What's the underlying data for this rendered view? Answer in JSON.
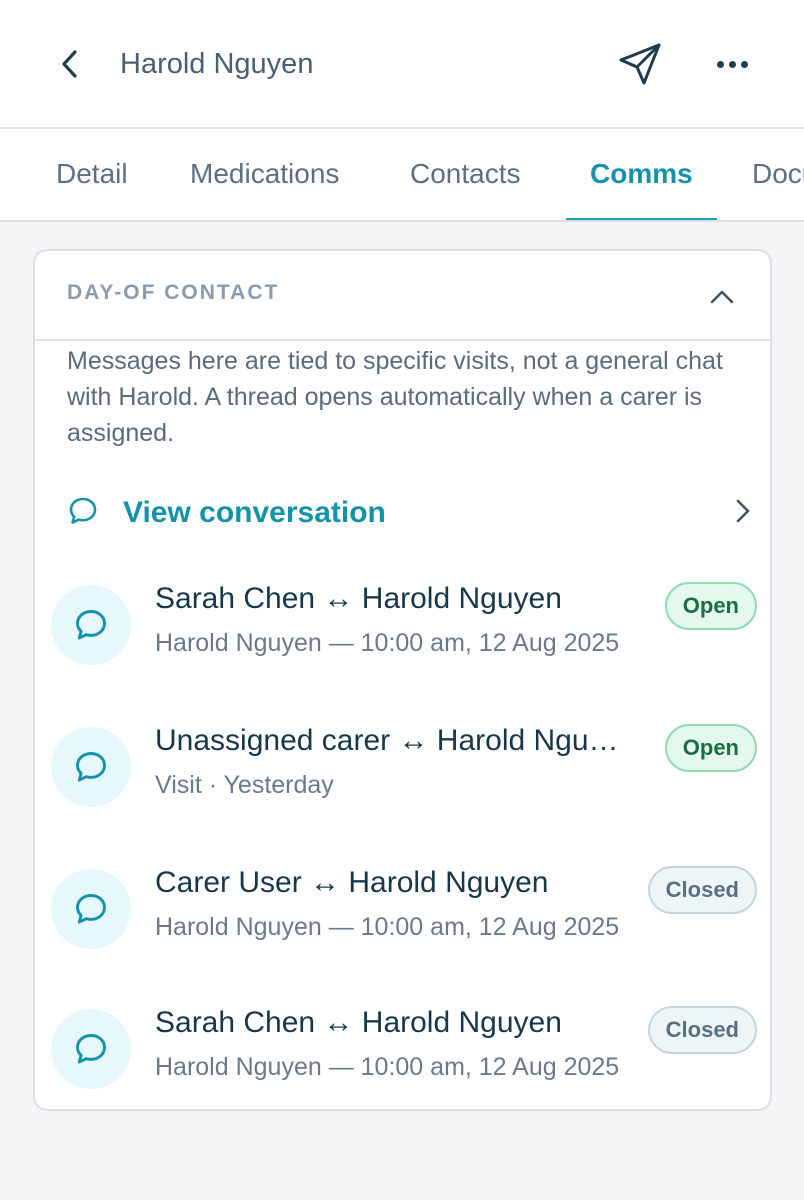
{
  "header": {
    "title": "Harold Nguyen",
    "back_icon": "chevron-left-icon",
    "send_icon": "send-icon",
    "more_icon": "more-horizontal-icon"
  },
  "tabs": [
    {
      "label": "Detail",
      "active": false
    },
    {
      "label": "Medications",
      "active": false
    },
    {
      "label": "Contacts",
      "active": false
    },
    {
      "label": "Comms",
      "active": true
    },
    {
      "label": "Documents",
      "active": false
    }
  ],
  "section": {
    "label": "DAY-OF CONTACT",
    "description": "Messages here are tied to specific visits, not a general chat with Harold. A thread opens automatically when a carer is assigned.",
    "view_conversation": "View conversation"
  },
  "threads": [
    {
      "title": "Sarah Chen ↔ Harold Nguyen",
      "subtitle": "Harold Nguyen — 10:00 am, 12 Aug 2025",
      "status": "Open"
    },
    {
      "title": "Unassigned carer ↔ Harold Nguyen",
      "subtitle": "Visit · Yesterday",
      "status": "Open"
    },
    {
      "title": "Carer User ↔ Harold Nguyen",
      "subtitle": "Harold Nguyen — 10:00 am, 12 Aug 2025",
      "status": "Closed"
    },
    {
      "title": "Sarah Chen ↔ Harold Nguyen",
      "subtitle": "Harold Nguyen — 10:00 am, 12 Aug 2025",
      "status": "Closed"
    }
  ],
  "colors": {
    "accent": "#1592ab",
    "open_badge_bg": "#e4f8ee",
    "open_badge_text": "#1b6e44",
    "closed_badge_bg": "#eef5f7",
    "closed_badge_text": "#58707f",
    "avatar_bg": "#e6f8fb"
  }
}
